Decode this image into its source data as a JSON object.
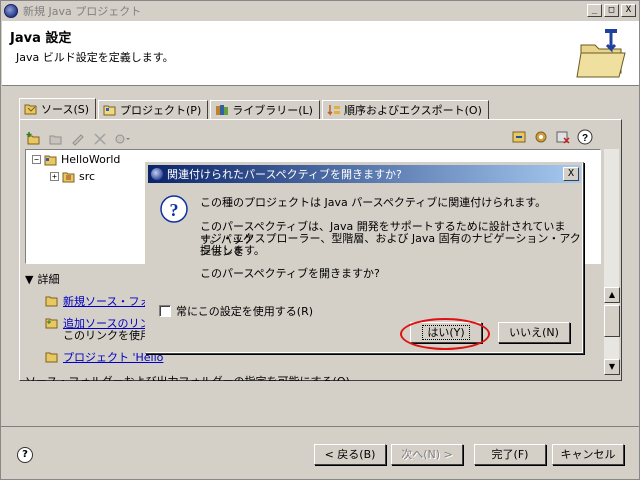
{
  "window": {
    "title": "新規 Java プロジェクト",
    "controls": [
      "_",
      "□",
      "X"
    ]
  },
  "header": {
    "title": "Java 設定",
    "description": "Java ビルド設定を定義します。"
  },
  "tabs": [
    {
      "label": "ソース(S)",
      "active": true
    },
    {
      "label": "プロジェクト(P)",
      "active": false
    },
    {
      "label": "ライブラリー(L)",
      "active": false
    },
    {
      "label": "順序およびエクスポート(O)",
      "active": false
    }
  ],
  "tree": {
    "project": "HelloWorld",
    "folder": "src"
  },
  "details": {
    "header": "詳細",
    "link1": "新規ソース・フォル",
    "link2": "追加ソースのリンク",
    "text2": "このリンクを使用し",
    "link3": "プロジェクト 'Hello",
    "text3": "ソース・フォルダーおよび出力フォルダーの指定を可能にする(O)"
  },
  "buttons": {
    "back": "< 戻る(B)",
    "next": "次へ(N) >",
    "finish": "完了(F)",
    "cancel": "キャンセル",
    "help": "?"
  },
  "dialog": {
    "title": "関連付けられたパースペクティブを開きますか?",
    "line1": "この種のプロジェクトは Java パースペクティブに関連付けられます。",
    "line2": "このパースペクティブは、Java 開発をサポートするために設計されています。パッケ",
    "line3": "ージ・エクスプローラー、型階層、および Java 固有のナビゲーション・アクションを",
    "line4": "提供します。",
    "line5": "このパースペクティブを開きますか?",
    "checkbox": "常にこの設定を使用する(R)",
    "yes": "はい(Y)",
    "no": "いいえ(N)",
    "close": "X"
  },
  "colors": {
    "annotation_oval": "#e01010",
    "title_gradient_start": "#0a246a",
    "title_gradient_end": "#a6caf0"
  }
}
